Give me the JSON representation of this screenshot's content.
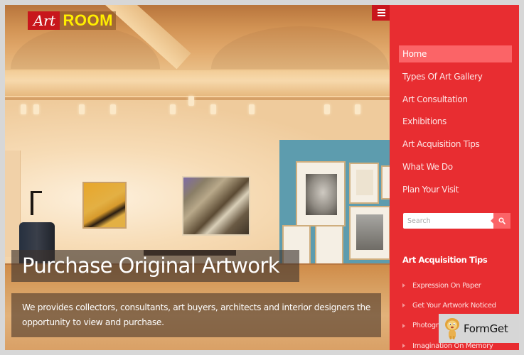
{
  "logo": {
    "part1": "Art",
    "part2": "ROOM"
  },
  "colors": {
    "accent": "#e82d31",
    "active_item": "#fb6467",
    "logo_red": "#c8161c",
    "logo_yellow": "#ffee00"
  },
  "header": {
    "menu_toggle_icon": "hamburger-icon"
  },
  "hero": {
    "image": "art-gallery-interior",
    "title": "Purchase Original Artwork",
    "description": "We provides collectors, consultants, art buyers, architects and interior designers the opportunity to view and purchase."
  },
  "sidebar": {
    "nav": [
      {
        "label": "Home",
        "active": true
      },
      {
        "label": "Types Of Art Gallery",
        "active": false
      },
      {
        "label": "Art Consultation",
        "active": false
      },
      {
        "label": "Exhibitions",
        "active": false
      },
      {
        "label": "Art Acquisition Tips",
        "active": false
      },
      {
        "label": "What We Do",
        "active": false
      },
      {
        "label": "Plan Your Visit",
        "active": false
      }
    ],
    "search": {
      "placeholder": "Search",
      "value": "",
      "button_icon": "search-icon"
    },
    "widget": {
      "title": "Art Acquisition Tips",
      "items": [
        "Expression On Paper",
        "Get Your Artwork Noticed",
        "Photography",
        "Imagination On Memory"
      ]
    }
  },
  "watermark": {
    "text": "FormGet",
    "icon": "lion-mascot-icon"
  }
}
